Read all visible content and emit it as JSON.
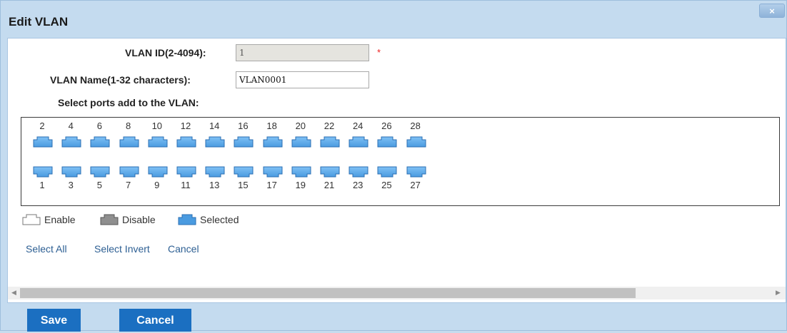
{
  "dialog": {
    "title": "Edit VLAN",
    "close_label": "×"
  },
  "form": {
    "vlan_id": {
      "label": "VLAN ID(2-4094):",
      "value": "1",
      "required_mark": "*"
    },
    "vlan_name": {
      "label": "VLAN Name(1-32 characters):",
      "value": "VLAN0001"
    },
    "ports_label": "Select ports add to the VLAN:"
  },
  "ports": {
    "top": [
      "2",
      "4",
      "6",
      "8",
      "10",
      "12",
      "14",
      "16",
      "18",
      "20",
      "22",
      "24",
      "26",
      "28"
    ],
    "bottom": [
      "1",
      "3",
      "5",
      "7",
      "9",
      "11",
      "13",
      "15",
      "17",
      "19",
      "21",
      "23",
      "25",
      "27"
    ],
    "state": "selected"
  },
  "legend": {
    "enable": "Enable",
    "disable": "Disable",
    "selected": "Selected"
  },
  "links": {
    "select_all": "Select All",
    "select_invert": "Select Invert",
    "cancel": "Cancel"
  },
  "colors": {
    "selected_fill": "#4a9be0",
    "enable_fill": "#ffffff",
    "disable_fill": "#8f8f8f"
  },
  "buttons": {
    "save": "Save",
    "cancel": "Cancel"
  }
}
